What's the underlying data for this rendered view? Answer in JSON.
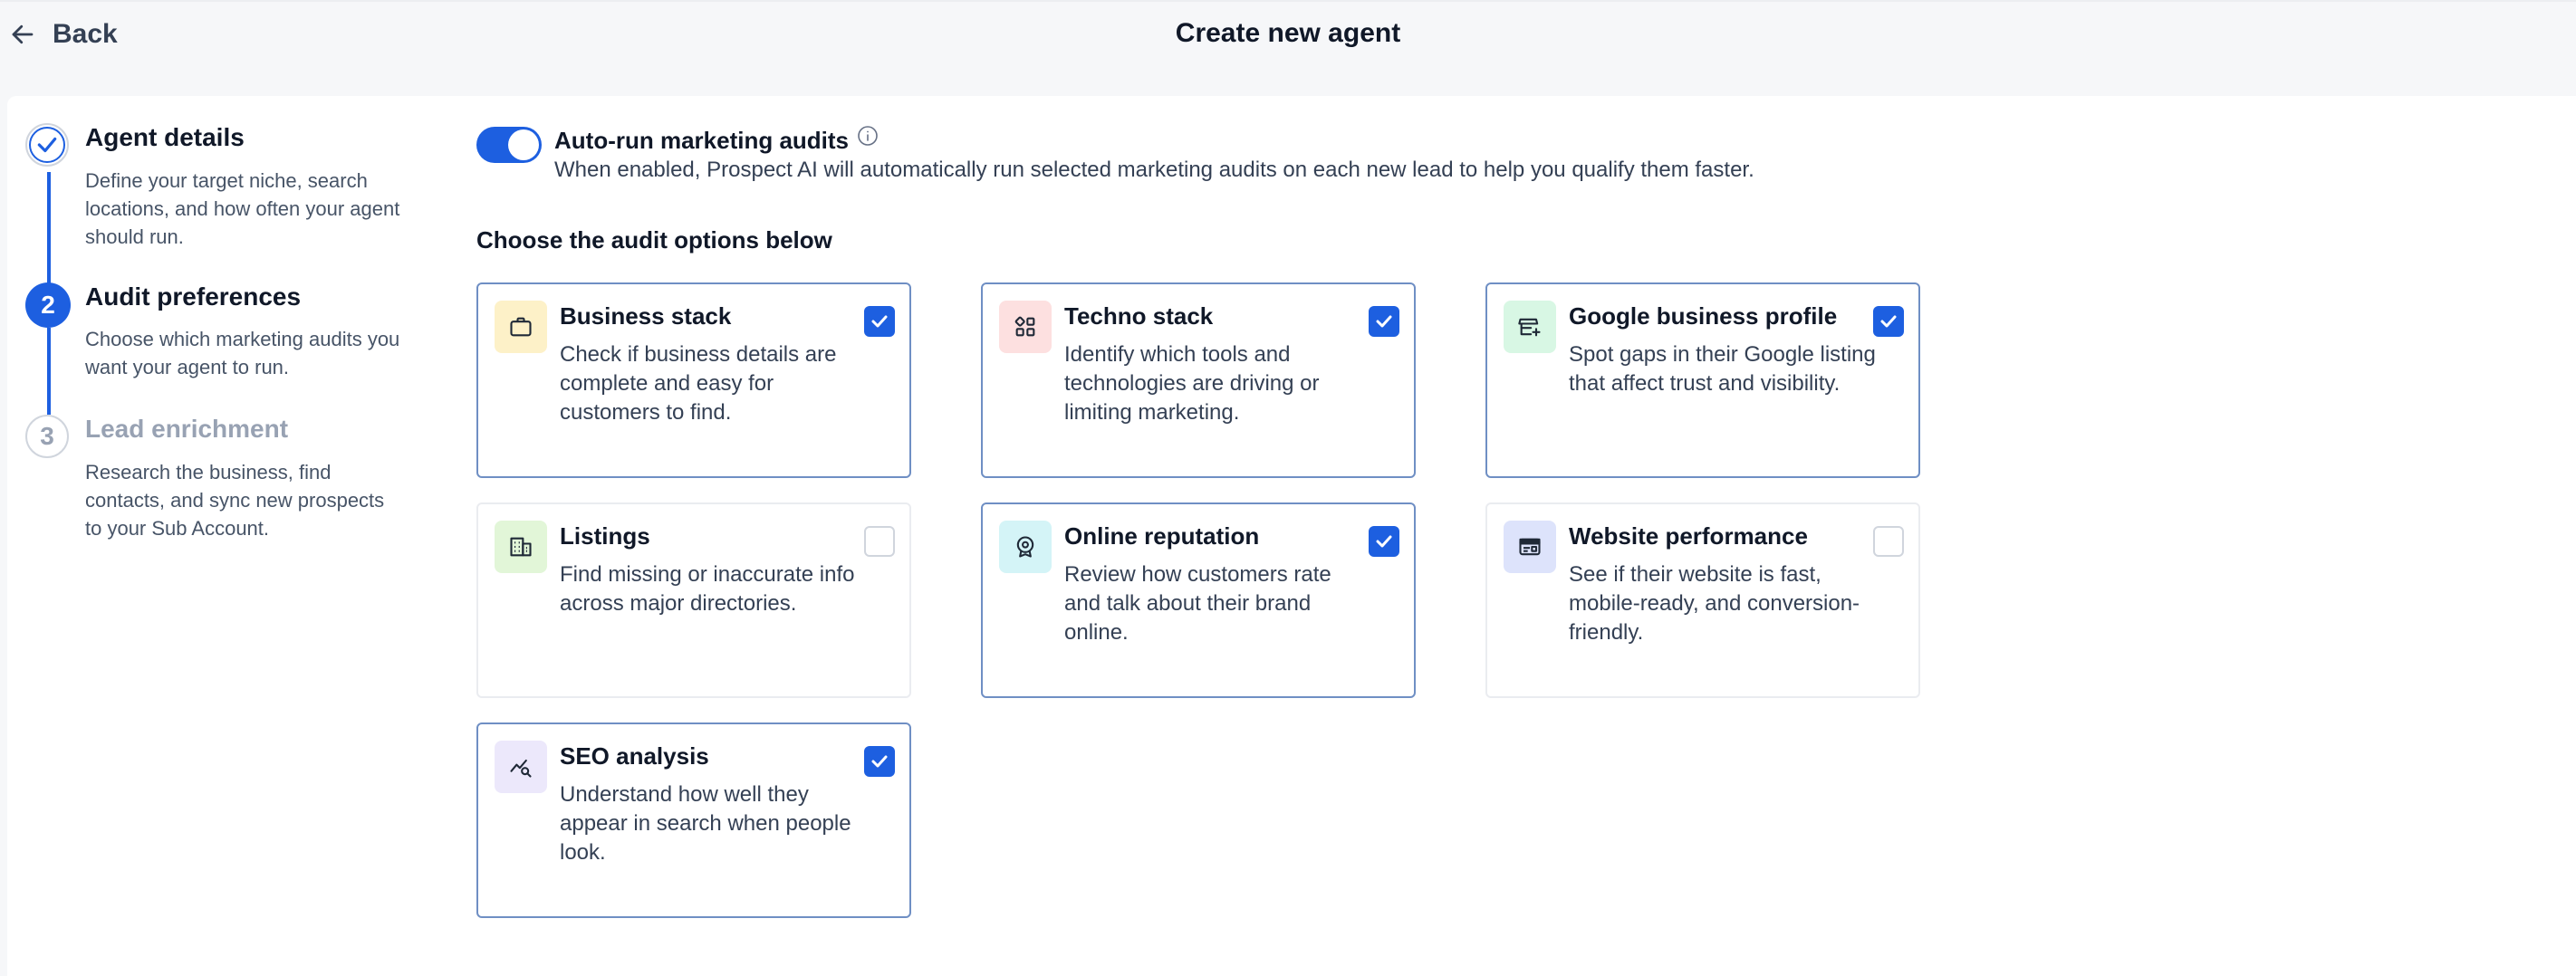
{
  "header": {
    "back_label": "Back",
    "title": "Create new agent"
  },
  "steps": [
    {
      "number": "",
      "title": "Agent details",
      "description": "Define your target niche, search locations, and how often your agent should run.",
      "status": "completed"
    },
    {
      "number": "2",
      "title": "Audit preferences",
      "description": "Choose which marketing audits you want your agent to run.",
      "status": "active"
    },
    {
      "number": "3",
      "title": "Lead enrichment",
      "description": "Research the business, find contacts, and sync new prospects to your Sub Account.",
      "status": "upcoming"
    }
  ],
  "auto_run": {
    "label": "Auto-run marketing audits",
    "description": "When enabled, Prospect AI will automatically run selected marketing audits on each new lead to help you qualify them faster.",
    "enabled": true
  },
  "audit_section_title": "Choose the audit options below",
  "audits": [
    {
      "title": "Business stack",
      "description": "Check if business details are complete and easy for customers to find.",
      "icon": "briefcase-icon",
      "icon_bg": "#fdf1c8",
      "checked": true
    },
    {
      "title": "Techno stack",
      "description": "Identify which tools and technologies are driving or limiting marketing.",
      "icon": "grid-icon",
      "icon_bg": "#fde0e0",
      "checked": true
    },
    {
      "title": "Google business profile",
      "description": "Spot gaps in their Google listing that affect trust and visibility.",
      "icon": "storefront-icon",
      "icon_bg": "#d8f7e4",
      "checked": true
    },
    {
      "title": "Listings",
      "description": "Find missing or inaccurate info across major directories.",
      "icon": "building-icon",
      "icon_bg": "#e2f6d8",
      "checked": false
    },
    {
      "title": "Online reputation",
      "description": "Review how customers rate and talk about their brand online.",
      "icon": "badge-icon",
      "icon_bg": "#d4f4f7",
      "checked": true
    },
    {
      "title": "Website performance",
      "description": "See if their website is fast, mobile-ready, and conversion-friendly.",
      "icon": "browser-icon",
      "icon_bg": "#dde3fb",
      "checked": false
    },
    {
      "title": "SEO analysis",
      "description": "Understand how well they appear in search when people look.",
      "icon": "seo-chart-icon",
      "icon_bg": "#ece8fb",
      "checked": true
    }
  ],
  "colors": {
    "primary": "#1d5fe0",
    "card_border_selected": "#6f8fc4",
    "card_border_unselected": "#eaecf0",
    "background": "#f6f7f9"
  }
}
